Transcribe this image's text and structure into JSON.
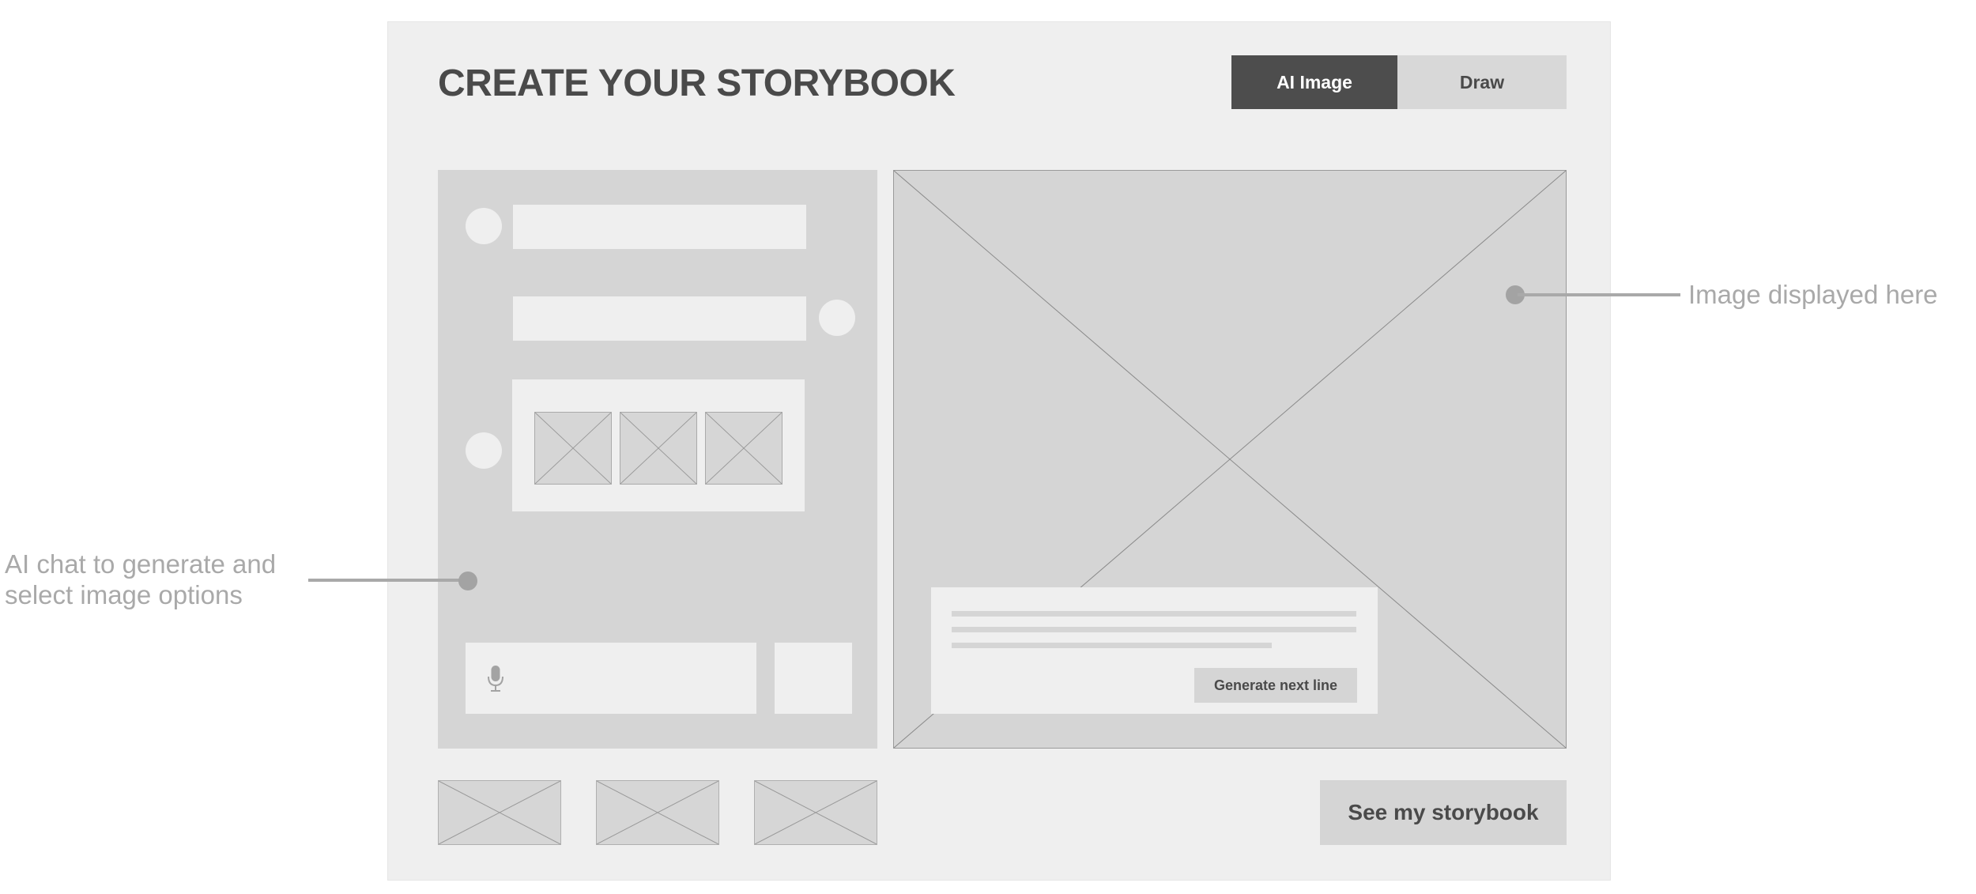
{
  "header": {
    "title": "CREATE YOUR STORYBOOK",
    "tabs": [
      {
        "label": "AI Image",
        "active": true
      },
      {
        "label": "Draw",
        "active": false
      }
    ]
  },
  "chat": {
    "input_icon": "microphone-icon",
    "image_options_count": 3
  },
  "image_panel": {
    "generate_button_label": "Generate next line"
  },
  "footer": {
    "see_storybook_label": "See my storybook",
    "thumbnail_count": 3
  },
  "annotations": {
    "chat_note": [
      "AI chat to generate and",
      "select image options"
    ],
    "image_note": "Image displayed here"
  },
  "colors": {
    "frame_bg": "#efefef",
    "panel_bg": "#d5d5d5",
    "active_tab": "#4d4d4d",
    "text_dark": "#4a4a4a",
    "annotation": "#a9a9a9"
  }
}
